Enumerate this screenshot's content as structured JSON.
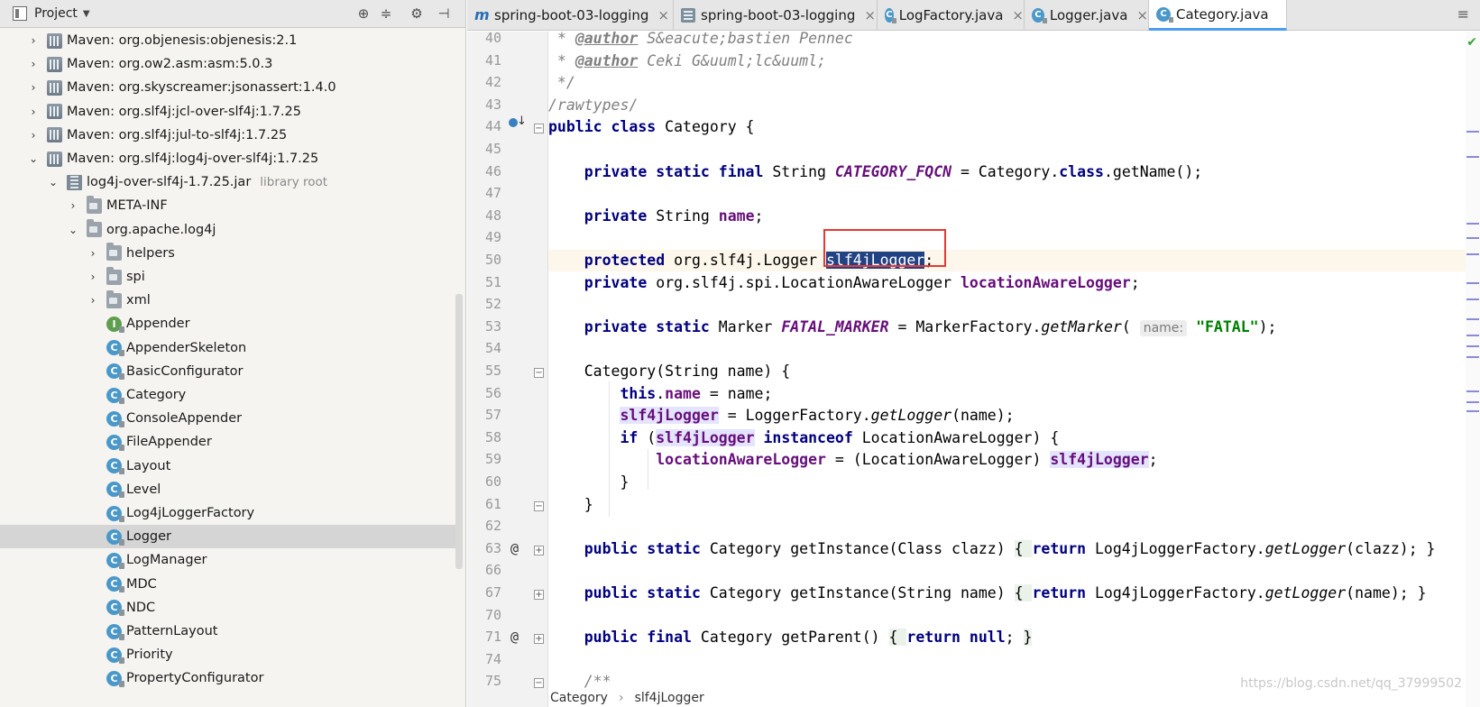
{
  "project_panel": {
    "title": "Project",
    "tree": [
      {
        "label": "Maven: org.objenesis:objenesis:2.1",
        "icon": "maven-library-icon",
        "arrow": "›",
        "indent": 0
      },
      {
        "label": "Maven: org.ow2.asm:asm:5.0.3",
        "icon": "maven-library-icon",
        "arrow": "›",
        "indent": 0
      },
      {
        "label": "Maven: org.skyscreamer:jsonassert:1.4.0",
        "icon": "maven-library-icon",
        "arrow": "›",
        "indent": 0
      },
      {
        "label": "Maven: org.slf4j:jcl-over-slf4j:1.7.25",
        "icon": "maven-library-icon",
        "arrow": "›",
        "indent": 0
      },
      {
        "label": "Maven: org.slf4j:jul-to-slf4j:1.7.25",
        "icon": "maven-library-icon",
        "arrow": "›",
        "indent": 0
      },
      {
        "label": "Maven: org.slf4j:log4j-over-slf4j:1.7.25",
        "icon": "maven-library-icon",
        "arrow": "⌄",
        "indent": 0
      },
      {
        "label": "log4j-over-slf4j-1.7.25.jar",
        "suffix": "library root",
        "icon": "jar-icon",
        "arrow": "⌄",
        "indent": 1
      },
      {
        "label": "META-INF",
        "icon": "package-folder-icon",
        "arrow": "›",
        "indent": 2
      },
      {
        "label": "org.apache.log4j",
        "icon": "package-folder-icon",
        "arrow": "⌄",
        "indent": 2
      },
      {
        "label": "helpers",
        "icon": "package-folder-icon",
        "arrow": "›",
        "indent": 3
      },
      {
        "label": "spi",
        "icon": "package-folder-icon",
        "arrow": "›",
        "indent": 3
      },
      {
        "label": "xml",
        "icon": "package-folder-icon",
        "arrow": "›",
        "indent": 3
      },
      {
        "label": "Appender",
        "icon": "interface-icon",
        "arrow": "",
        "indent": 3
      },
      {
        "label": "AppenderSkeleton",
        "icon": "class-icon",
        "arrow": "",
        "indent": 3
      },
      {
        "label": "BasicConfigurator",
        "icon": "class-icon",
        "arrow": "",
        "indent": 3
      },
      {
        "label": "Category",
        "icon": "class-icon",
        "arrow": "",
        "indent": 3
      },
      {
        "label": "ConsoleAppender",
        "icon": "class-icon",
        "arrow": "",
        "indent": 3
      },
      {
        "label": "FileAppender",
        "icon": "class-icon",
        "arrow": "",
        "indent": 3
      },
      {
        "label": "Layout",
        "icon": "class-icon",
        "arrow": "",
        "indent": 3
      },
      {
        "label": "Level",
        "icon": "class-icon",
        "arrow": "",
        "indent": 3
      },
      {
        "label": "Log4jLoggerFactory",
        "icon": "class-icon",
        "arrow": "",
        "indent": 3
      },
      {
        "label": "Logger",
        "icon": "class-icon",
        "arrow": "",
        "indent": 3,
        "selected": true
      },
      {
        "label": "LogManager",
        "icon": "class-icon",
        "arrow": "",
        "indent": 3
      },
      {
        "label": "MDC",
        "icon": "class-icon",
        "arrow": "",
        "indent": 3
      },
      {
        "label": "NDC",
        "icon": "class-icon",
        "arrow": "",
        "indent": 3
      },
      {
        "label": "PatternLayout",
        "icon": "class-icon",
        "arrow": "",
        "indent": 3
      },
      {
        "label": "Priority",
        "icon": "class-icon",
        "arrow": "",
        "indent": 3
      },
      {
        "label": "PropertyConfigurator",
        "icon": "class-icon",
        "arrow": "",
        "indent": 3
      }
    ]
  },
  "tabs": [
    {
      "label": "spring-boot-03-logging",
      "icon": "maven-m-icon",
      "active": false
    },
    {
      "label": "spring-boot-03-logging",
      "icon": "properties-file-icon",
      "active": false
    },
    {
      "label": "LogFactory.java",
      "icon": "class-icon",
      "active": false
    },
    {
      "label": "Logger.java",
      "icon": "class-icon",
      "active": false
    },
    {
      "label": "Category.java",
      "icon": "class-icon",
      "active": true
    }
  ],
  "editor": {
    "lines": [
      {
        "n": "40",
        "html": "<span class=\"cmt\"> * </span><span class=\"doc-tag\">@author</span><span class=\"cmt\"> S&amp;eacute;bastien Pennec</span>"
      },
      {
        "n": "41",
        "html": "<span class=\"cmt\"> * </span><span class=\"doc-tag\">@author</span><span class=\"cmt\"> Ceki G&amp;uuml;lc&amp;uuml;</span>"
      },
      {
        "n": "42",
        "html": "<span class=\"cmt\"> */</span>"
      },
      {
        "n": "43",
        "html": "<span class=\"cmt\">/rawtypes/</span>"
      },
      {
        "n": "44",
        "html": "<span class=\"kw\">public class</span> Category {"
      },
      {
        "n": "45",
        "html": ""
      },
      {
        "n": "46",
        "html": "    <span class=\"kw\">private static final</span> String <span class=\"sfld\">CATEGORY_FQCN</span> = Category.<span class=\"kw\">class</span>.getName();"
      },
      {
        "n": "47",
        "html": ""
      },
      {
        "n": "48",
        "html": "    <span class=\"kw\">private</span> String <span class=\"fld\">name</span>;"
      },
      {
        "n": "49",
        "html": ""
      },
      {
        "n": "50",
        "html": "    <span class=\"kw\">protected</span> org.slf4j.Logger <span class=\"sel-word\">slf4jLogger</span>;",
        "current": true
      },
      {
        "n": "51",
        "html": "    <span class=\"kw\">private</span> org.slf4j.spi.LocationAwareLogger <span class=\"fld\">locationAwareLogger</span>;"
      },
      {
        "n": "52",
        "html": ""
      },
      {
        "n": "53",
        "html": "    <span class=\"kw\">private static</span> Marker <span class=\"sfld\">FATAL_MARKER</span> = MarkerFactory.<span class=\"smeth\">getMarker</span>( <span class=\"param-hint\">name:</span> <span class=\"str\">\"FATAL\"</span>);"
      },
      {
        "n": "54",
        "html": ""
      },
      {
        "n": "55",
        "html": "    Category(String name) {"
      },
      {
        "n": "56",
        "html": "        <span class=\"kw\">this</span>.<span class=\"fld\">name</span> = name;"
      },
      {
        "n": "57",
        "html": "        <span class=\"fld usage\">slf4jLogger</span> = LoggerFactory.<span class=\"smeth\">getLogger</span>(name);"
      },
      {
        "n": "58",
        "html": "        <span class=\"kw\">if</span> (<span class=\"fld usage\">slf4jLogger</span> <span class=\"kw\">instanceof</span> LocationAwareLogger) {"
      },
      {
        "n": "59",
        "html": "            <span class=\"fld\">locationAwareLogger</span> = (LocationAwareLogger) <span class=\"fld usage\">slf4jLogger</span>;"
      },
      {
        "n": "60",
        "html": "        }"
      },
      {
        "n": "61",
        "html": "    }"
      },
      {
        "n": "62",
        "html": ""
      },
      {
        "n": "63",
        "html": "    <span class=\"kw\">public static</span> Category getInstance(Class clazz) <span class=\"fold-brace\">{ </span><span class=\"kw\">return</span> Log4jLoggerFactory.<span class=\"smeth\">getLogger</span>(clazz); }"
      },
      {
        "n": "66",
        "html": ""
      },
      {
        "n": "67",
        "html": "    <span class=\"kw\">public static</span> Category getInstance(String name) <span class=\"fold-brace\">{ </span><span class=\"kw\">return</span> Log4jLoggerFactory.<span class=\"smeth\">getLogger</span>(name); }"
      },
      {
        "n": "70",
        "html": ""
      },
      {
        "n": "71",
        "html": "    <span class=\"kw\">public final</span> Category getParent() <span class=\"fold-brace\">{ </span><span class=\"kw\">return null</span>; <span class=\"fold-brace\">}</span>"
      },
      {
        "n": "74",
        "html": ""
      },
      {
        "n": "75",
        "html": "    <span class=\"cmt\">/**</span>"
      }
    ],
    "gutter_at_lines": [
      "63",
      "71"
    ],
    "gutter_at_symbol": "@"
  },
  "breadcrumb": [
    "Category",
    "slf4jLogger"
  ],
  "watermark": "https://blog.csdn.net/qq_37999502"
}
